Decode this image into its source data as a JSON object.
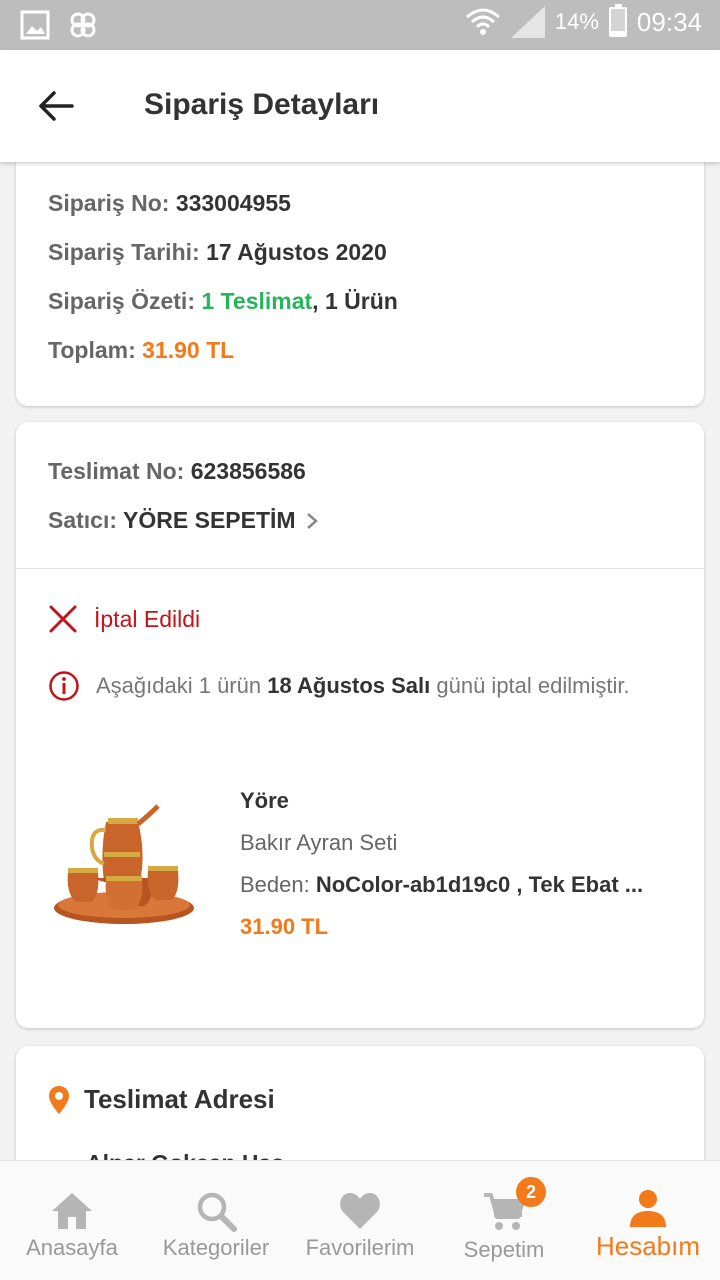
{
  "status_bar": {
    "battery": "14%",
    "time": "09:34"
  },
  "header": {
    "title": "Sipariş Detayları"
  },
  "order": {
    "no_label": "Sipariş No:",
    "no_value": "333004955",
    "date_label": "Sipariş Tarihi:",
    "date_value": "17 Ağustos 2020",
    "summary_label": "Sipariş Özeti:",
    "summary_delivery": "1 Teslimat",
    "summary_items": ", 1 Ürün",
    "total_label": "Toplam:",
    "total_value": "31.90 TL"
  },
  "delivery": {
    "no_label": "Teslimat No:",
    "no_value": "623856586",
    "seller_label": "Satıcı:",
    "seller_value": "YÖRE SEPETİM",
    "status": "İptal Edildi",
    "info_prefix": "Aşağıdaki 1 ürün",
    "info_date": "18 Ağustos Salı",
    "info_suffix": "günü iptal edilmiştir."
  },
  "product": {
    "brand": "Yöre",
    "name": "Bakır Ayran Seti",
    "size_label": "Beden:",
    "size_value": "NoColor-ab1d19c0 , Tek Ebat ...",
    "price": "31.90 TL"
  },
  "address": {
    "title": "Teslimat Adresi",
    "name": "Alper Gokcan Has..."
  },
  "nav": {
    "home": "Anasayfa",
    "categories": "Kategoriler",
    "favorites": "Favorilerim",
    "cart": "Sepetim",
    "cart_badge": "2",
    "account": "Hesabım"
  },
  "colors": {
    "accent": "#f27a1a",
    "success": "#26b55b",
    "danger": "#c2141b"
  }
}
